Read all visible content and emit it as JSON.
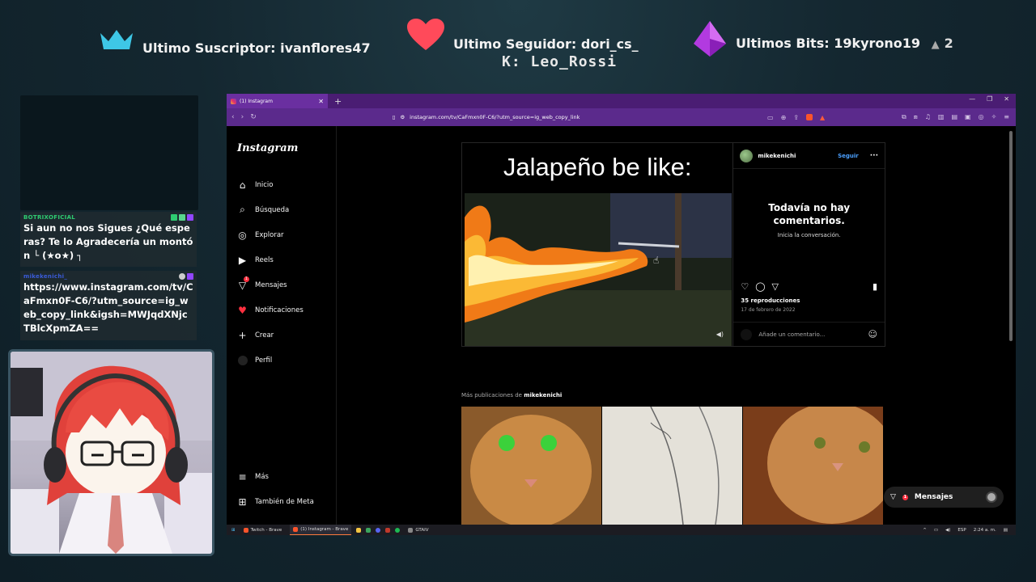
{
  "alerts": {
    "subscriber": "Ultimo Suscriptor: ivanflores47",
    "follower": "Ultimo Seguidor: dori_cs_",
    "bits": "Ultimos Bits: 19kyrono19",
    "bits_count": "2",
    "ticker": "K: Leo_Rossi"
  },
  "chat": [
    {
      "user": "BOTRIXOFICIAL",
      "user_color": "#2ecc71",
      "message": "Si aun no nos Sigues ¿Qué esperas? Te lo Agradecería un montón └ (★o★) ┐"
    },
    {
      "user": "mikekenichi_",
      "user_color": "#3a5bd9",
      "message": "https://www.instagram.com/tv/CaFmxn0F-C6/?utm_source=ig_web_copy_link&igsh=MWJqdXNjcTBlcXpmZA=="
    }
  ],
  "browser": {
    "tab_title": "(1) Instagram",
    "new_tab": "+",
    "url": "instagram.com/tv/CaFmxn0F-C6/?utm_source=ig_web_copy_link"
  },
  "instagram": {
    "logo": "Instagram",
    "nav": [
      {
        "label": "Inicio",
        "icon": "home-icon"
      },
      {
        "label": "Búsqueda",
        "icon": "search-icon"
      },
      {
        "label": "Explorar",
        "icon": "compass-icon"
      },
      {
        "label": "Reels",
        "icon": "reels-icon"
      },
      {
        "label": "Mensajes",
        "icon": "messenger-icon"
      },
      {
        "label": "Notificaciones",
        "icon": "heart-icon"
      },
      {
        "label": "Crear",
        "icon": "plus-icon"
      },
      {
        "label": "Perfil",
        "icon": "profile-icon"
      }
    ],
    "nav_bottom": [
      {
        "label": "Más",
        "icon": "menu-icon"
      },
      {
        "label": "También de Meta",
        "icon": "meta-icon"
      }
    ],
    "messages_badge": "1",
    "post": {
      "title": "Jalapeño be like:",
      "username": "mikekenichi",
      "follow": "Seguir",
      "no_comments": "Todavía no hay comentarios.",
      "start_conversation": "Inicia la conversación.",
      "views": "35 reproducciones",
      "date": "17 de febrero de 2022",
      "comment_placeholder": "Añade un comentario..."
    },
    "more_from_prefix": "Más publicaciones de",
    "more_from_user": "mikekenichi",
    "messages_pill": "Mensajes",
    "messages_pill_badge": "1"
  },
  "taskbar": {
    "items": [
      "Twitch - Brave",
      "(1) Instagram - Brave",
      "GTAIV"
    ],
    "lang": "ESP",
    "time": "2:24 a. m."
  },
  "colors": {
    "tab_bar": "#4a1d73",
    "url_bar": "#5b2a8c",
    "follow_link": "#4a9fff",
    "notification": "#ff3040"
  }
}
